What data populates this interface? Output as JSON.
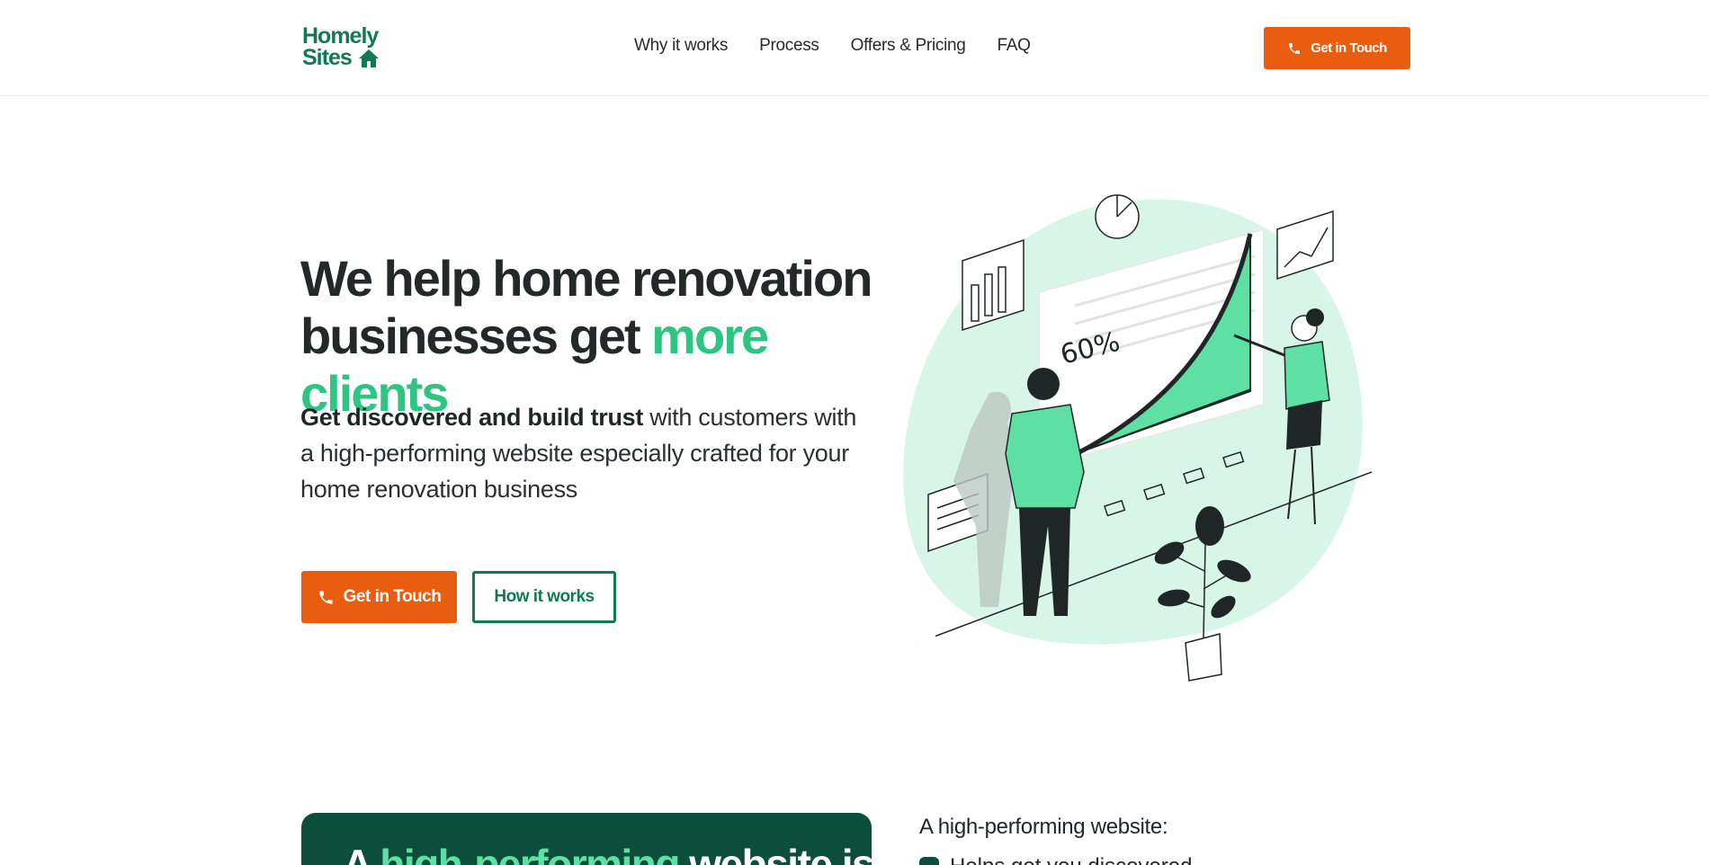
{
  "header": {
    "logo": {
      "line1": "Homely",
      "line2": "Sites"
    },
    "nav": [
      {
        "label": "Why it works"
      },
      {
        "label": "Process"
      },
      {
        "label": "Offers & Pricing"
      },
      {
        "label": "FAQ"
      }
    ],
    "cta_label": "Get in Touch"
  },
  "hero": {
    "title_main": "We help home renovation businesses get ",
    "title_accent": "more clients",
    "subtitle_bold": "Get discovered and build trust",
    "subtitle_rest": " with customers with a high-performing website especially crafted for your home renovation business",
    "primary_label": "Get in Touch",
    "secondary_label": "How it works",
    "illustration_stat": "60%"
  },
  "section2": {
    "card_title_start": "A ",
    "card_title_accent": "high-performing",
    "card_title_end": " website is",
    "list_label": "A high-performing website:",
    "list_first_item": "Helps get you discovered"
  },
  "colors": {
    "brand_green": "#117a55",
    "accent_green": "#2ec583",
    "orange": "#e85d10",
    "dark_green": "#0d4d3b",
    "mint": "#d8f6e7"
  }
}
